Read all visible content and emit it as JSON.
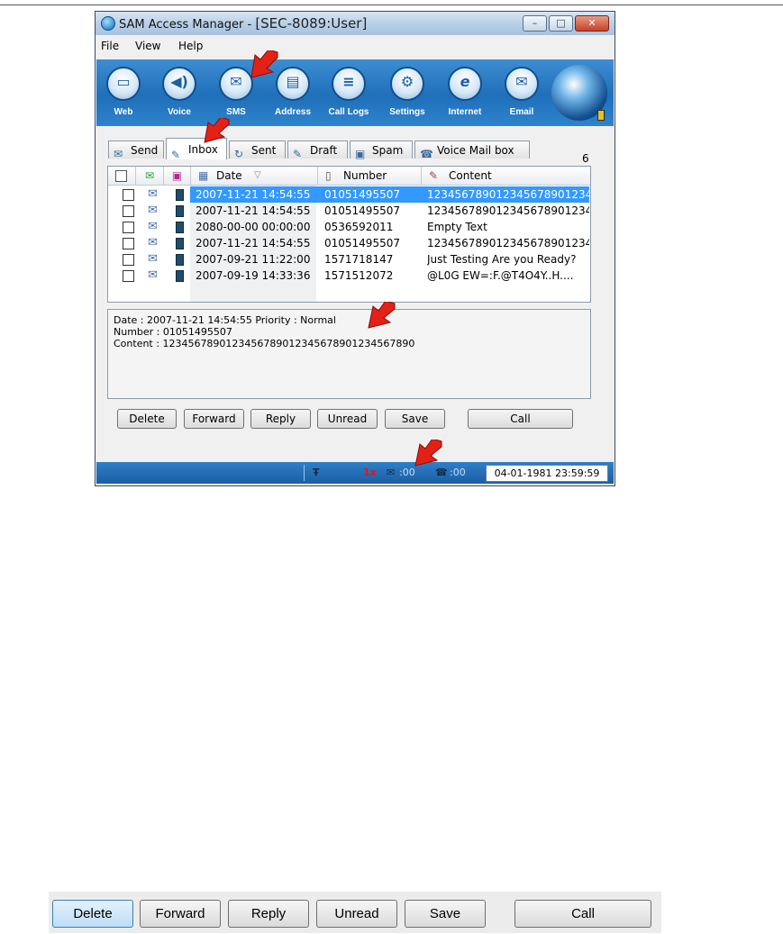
{
  "window": {
    "title_prefix": "SAM Access Manager - ",
    "title_highlight": "[SEC-8089:User]",
    "controls": {
      "minimize": "–",
      "maximize": "□",
      "close": "✕"
    }
  },
  "menu": [
    {
      "label": "File"
    },
    {
      "label": "View"
    },
    {
      "label": "Help"
    }
  ],
  "toolbar": [
    {
      "label": "Web",
      "icon": "web-icon",
      "glyph": "▭"
    },
    {
      "label": "Voice",
      "icon": "speaker-icon",
      "glyph": "◀)"
    },
    {
      "label": "SMS",
      "icon": "envelope-icon",
      "glyph": "✉"
    },
    {
      "label": "Address",
      "icon": "address-book-icon",
      "glyph": "▤"
    },
    {
      "label": "Call Logs",
      "icon": "call-logs-icon",
      "glyph": "≡"
    },
    {
      "label": "Settings",
      "icon": "gear-icon",
      "glyph": "⚙"
    },
    {
      "label": "Internet",
      "icon": "internet-explorer-icon",
      "glyph": "e"
    },
    {
      "label": "Email",
      "icon": "email-icon",
      "glyph": "✉"
    }
  ],
  "tabs": [
    {
      "label": "Send",
      "icon": "send-icon",
      "glyph": "✉"
    },
    {
      "label": "Inbox",
      "icon": "inbox-icon",
      "glyph": "✎"
    },
    {
      "label": "Sent",
      "icon": "sent-icon",
      "glyph": "↻"
    },
    {
      "label": "Draft",
      "icon": "draft-icon",
      "glyph": "✎"
    },
    {
      "label": "Spam",
      "icon": "spam-icon",
      "glyph": "▣"
    },
    {
      "label": "Voice Mail box",
      "icon": "voicemail-icon",
      "glyph": "☎"
    }
  ],
  "message_count": "6",
  "list": {
    "columns": {
      "date": "Date",
      "sort_glyph": "▽",
      "number": "Number",
      "content": "Content"
    },
    "rows": [
      {
        "date": "2007-11-21 14:54:55",
        "number": "01051495507",
        "content": "1234567890123456789012345...",
        "selected": true
      },
      {
        "date": "2007-11-21 14:54:55",
        "number": "01051495507",
        "content": "1234567890123456789012345...",
        "selected": false
      },
      {
        "date": "2080-00-00 00:00:00",
        "number": "0536592011",
        "content": "Empty Text",
        "selected": false
      },
      {
        "date": "2007-11-21 14:54:55",
        "number": "01051495507",
        "content": "1234567890123456789012345...",
        "selected": false
      },
      {
        "date": "2007-09-21 11:22:00",
        "number": "1571718147",
        "content": "Just Testing Are you Ready?",
        "selected": false
      },
      {
        "date": "2007-09-19 14:33:36",
        "number": "1571512072",
        "content": "@L0G EW=:F.@T4O4Y..H....",
        "selected": false
      }
    ]
  },
  "detail": {
    "line1": "Date  : 2007-11-21 14:54:55    Priority  : Normal",
    "line2": "Number : 01051495507",
    "line3": "Content : 1234567890123456789012345678901234567890"
  },
  "buttons": {
    "delete": "Delete",
    "forward": "Forward",
    "reply": "Reply",
    "unread": "Unread",
    "save": "Save",
    "call": "Call"
  },
  "status": {
    "signal_glyph": "Ŧ",
    "network": "1x",
    "sms_count": ":00",
    "call_count": ":00",
    "datetime": "04-01-1981 23:59:59"
  },
  "colors": {
    "toolbar_blue": "#1f6fb9",
    "selection": "#3399ff",
    "arrow_red": "#e32116"
  }
}
